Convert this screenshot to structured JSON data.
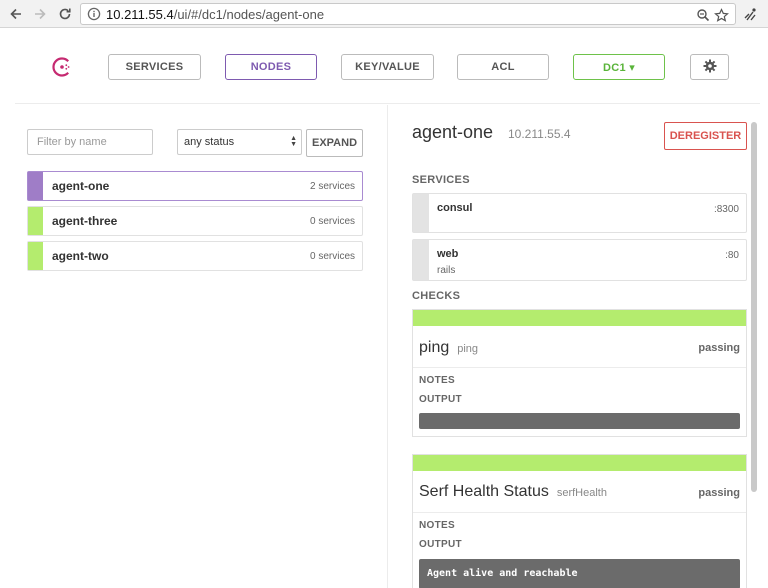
{
  "browser": {
    "url_host": "10.211.55.4",
    "url_path": "/ui/#/dc1/nodes/agent-one"
  },
  "topnav": {
    "items": [
      {
        "label": "SERVICES"
      },
      {
        "label": "NODES"
      },
      {
        "label": "KEY/VALUE"
      },
      {
        "label": "ACL"
      }
    ],
    "datacenter": "DC1 ▾",
    "colors": {
      "accent": "#7e5ab0",
      "datacenter": "#6ec24a",
      "logo": "#c62a71"
    }
  },
  "filter": {
    "placeholder": "Filter by name",
    "status_selected": "any status",
    "expand_label": "EXPAND"
  },
  "nodes": [
    {
      "name": "agent-one",
      "services": "2 services",
      "color": "#9f7dc7"
    },
    {
      "name": "agent-three",
      "services": "0 services",
      "color": "#b4ec6e"
    },
    {
      "name": "agent-two",
      "services": "0 services",
      "color": "#b4ec6e"
    }
  ],
  "detail": {
    "name": "agent-one",
    "address": "10.211.55.4",
    "deregister_label": "DEREGISTER",
    "services_label": "SERVICES",
    "checks_label": "CHECKS",
    "services": [
      {
        "name": "consul",
        "port": ":8300",
        "tag": ""
      },
      {
        "name": "web",
        "port": ":80",
        "tag": "rails"
      }
    ],
    "checks": [
      {
        "name": "ping",
        "id": "ping",
        "status": "passing",
        "notes_label": "NOTES",
        "output_label": "OUTPUT",
        "output": ""
      },
      {
        "name": "Serf Health Status",
        "id": "serfHealth",
        "status": "passing",
        "notes_label": "NOTES",
        "output_label": "OUTPUT",
        "output": "Agent alive and reachable"
      }
    ],
    "status_color": "#b4ec6e"
  }
}
